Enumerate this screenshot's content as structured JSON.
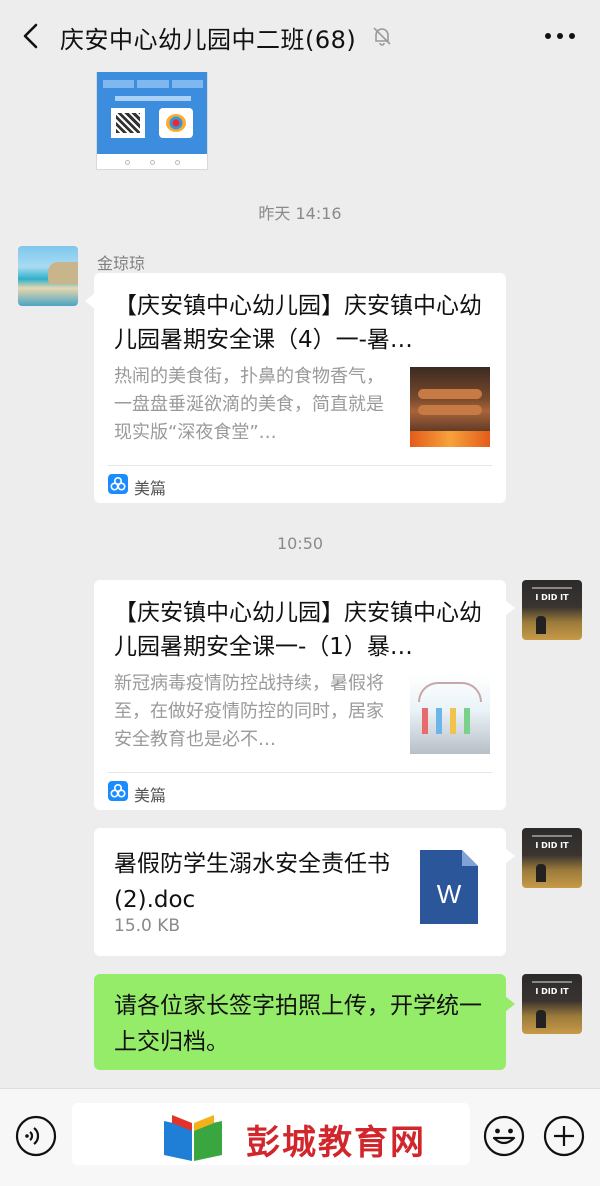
{
  "header": {
    "title": "庆安中心幼儿园中二班(68)"
  },
  "timestamps": [
    "昨天 14:16",
    "10:50"
  ],
  "messages": {
    "link1": {
      "sender": "金琼琼",
      "title": "【庆安镇中心幼儿园】庆安镇中心幼儿园暑期安全课（4）一-暑…",
      "description": "热闹的美食街，扑鼻的食物香气，一盘盘垂涎欲滴的美食，简直就是现实版“深夜食堂”…",
      "source": "美篇"
    },
    "link2": {
      "title": "【庆安镇中心幼儿园】庆安镇中心幼儿园暑期安全课一-（1）暴…",
      "description": "新冠病毒疫情防控战持续，暑假将至，在做好疫情防控的同时，居家安全教育也是必不…",
      "source": "美篇"
    },
    "file": {
      "name": "暑假防学生溺水安全责任书(2).doc",
      "size": "15.0 KB",
      "icon_letter": "W"
    },
    "text": {
      "content": "请各位家长签字拍照上传，开学统一上交归档。"
    }
  },
  "avatar": {
    "self_text": "I DID IT"
  },
  "watermark": {
    "text": "彭城教育网"
  },
  "colors": {
    "background": "#ededed",
    "bubble_green": "#95ec69",
    "meipian_blue": "#1a8cff",
    "word_blue": "#2b579a",
    "watermark_red": "#d1262c"
  }
}
